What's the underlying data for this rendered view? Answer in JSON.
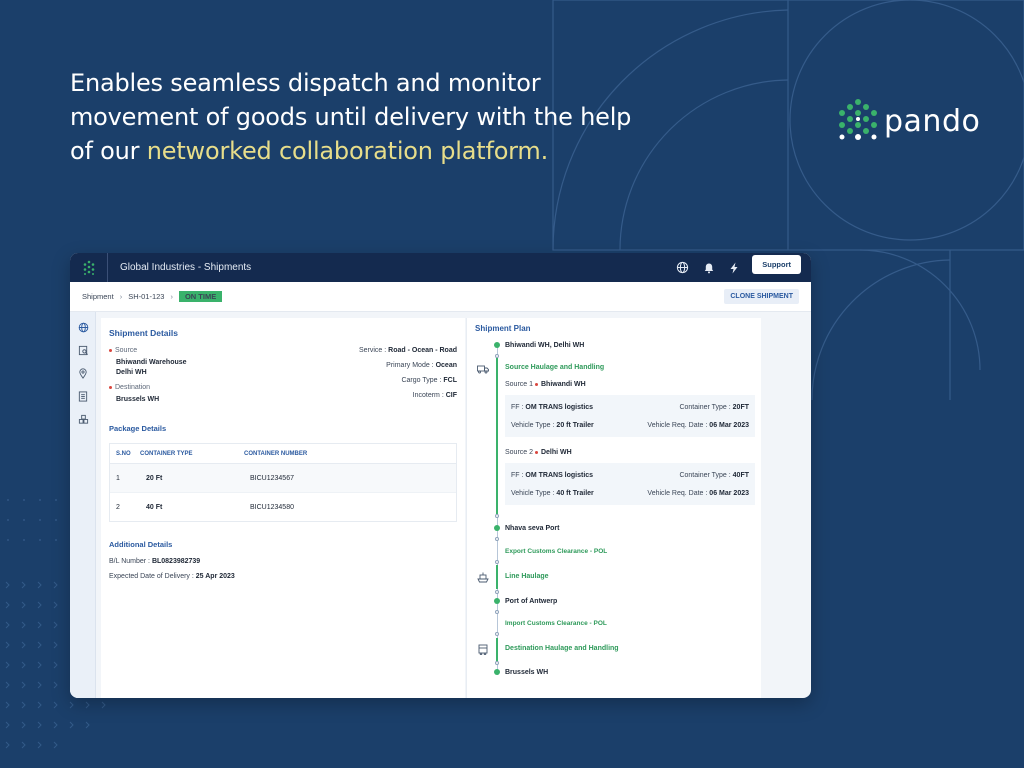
{
  "headline": {
    "part1": "Enables seamless dispatch and monitor movement of goods until delivery with the help of our ",
    "highlight": "networked collaboration platform."
  },
  "logo": {
    "text": "pando",
    "icon": "dotted-hexagon-logo-icon"
  },
  "colors": {
    "background": "#1b3f6a",
    "topbar": "#142a4f",
    "accent": "#2b5aa0",
    "green": "#3ab26b",
    "highlight": "#e7dd8a"
  },
  "app": {
    "title": "Global Industries - Shipments",
    "support_label": "Support",
    "breadcrumb": {
      "root": "Shipment",
      "id": "SH-01-123",
      "status": "ON TIME"
    },
    "clone_label": "CLONE SHIPMENT",
    "shipment_details": {
      "title": "Shipment Details",
      "source_label": "Source",
      "source_line1": "Bhiwandi Warehouse",
      "source_line2": "Delhi WH",
      "destination_label": "Destination",
      "destination_value": "Brussels WH",
      "service_label": "Service :",
      "service_value": "Road - Ocean - Road",
      "primary_mode_label": "Primary Mode :",
      "primary_mode_value": "Ocean",
      "cargo_type_label": "Cargo Type :",
      "cargo_type_value": "FCL",
      "incoterm_label": "Incoterm :",
      "incoterm_value": "CIF"
    },
    "package_details": {
      "title": "Package Details",
      "headers": [
        "S.NO",
        "CONTAINER TYPE",
        "CONTAINER NUMBER"
      ],
      "rows": [
        [
          "1",
          "20 Ft",
          "BICU1234567"
        ],
        [
          "2",
          "40 Ft",
          "BICU1234580"
        ]
      ]
    },
    "additional_details": {
      "title": "Additional Details",
      "bl_label": "B/L Number :",
      "bl_value": "BL0823982739",
      "edd_label": "Expected Date of Delivery :",
      "edd_value": "25 Apr 2023"
    },
    "shipment_plan": {
      "title": "Shipment Plan",
      "origin": "Bhiwandi WH, Delhi WH",
      "source_haulage": "Source Haulage and Handling",
      "source1_label": "Source 1",
      "source1_value": "Bhiwandi WH",
      "card1": {
        "ff_label": "FF :",
        "ff_value": "OM TRANS logistics",
        "ct_label": "Container Type :",
        "ct_value": "20FT",
        "vt_label": "Vehicle Type :",
        "vt_value": "20 ft Trailer",
        "vd_label": "Vehicle Req. Date :",
        "vd_value": "06 Mar 2023"
      },
      "source2_label": "Source 2",
      "source2_value": "Delhi WH",
      "card2": {
        "ff_label": "FF :",
        "ff_value": "OM TRANS logistics",
        "ct_label": "Container Type :",
        "ct_value": "40FT",
        "vt_label": "Vehicle Type :",
        "vt_value": "40 ft Trailer",
        "vd_label": "Vehicle Req. Date :",
        "vd_value": "06 Mar 2023"
      },
      "port1": "Nhava seva Port",
      "export_customs": "Export Customs Clearance - POL",
      "line_haulage": "Line Haulage",
      "port2": "Port of Antwerp",
      "import_customs": "Import Customs Clearance - POL",
      "dest_haulage": "Destination Haulage and Handling",
      "destination": "Brussels WH"
    }
  }
}
